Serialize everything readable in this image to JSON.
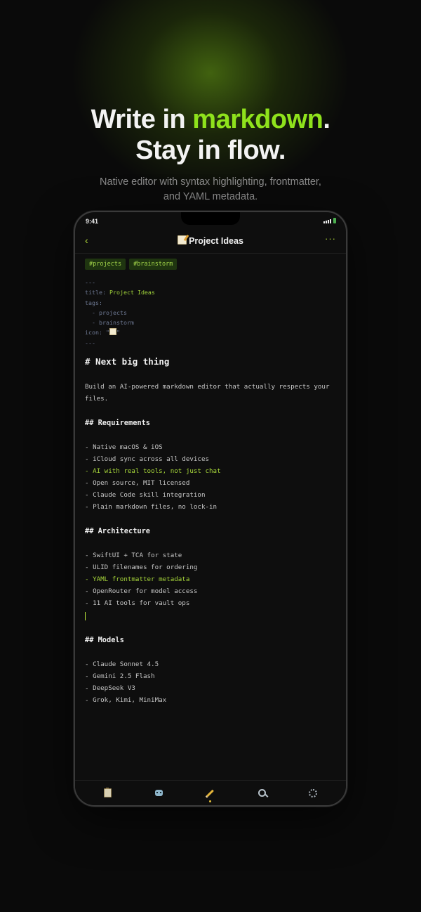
{
  "hero": {
    "title_line1_prefix": "Write in ",
    "title_line1_accent": "markdown",
    "title_line1_suffix": ".",
    "title_line2": "Stay in flow.",
    "subtitle": "Native editor with syntax highlighting, frontmatter, and YAML metadata."
  },
  "status_bar": {
    "time": "9:41"
  },
  "navbar": {
    "back": "‹",
    "title": "Project Ideas",
    "more": "···"
  },
  "tags": [
    "#projects",
    "#brainstorm"
  ],
  "frontmatter": {
    "open": "---",
    "title_key": "title:",
    "title_value": "Project Ideas",
    "tags_key": "tags:",
    "tag_items": [
      "  - projects",
      "  - brainstorm"
    ],
    "icon_key": "icon:",
    "icon_quote_open": "\"",
    "icon_quote_close": "\"",
    "close": "---"
  },
  "document": {
    "h1": "# Next big thing",
    "paragraph": "Build an AI-powered markdown editor that actually respects your files.",
    "sections": [
      {
        "heading": "## Requirements",
        "items": [
          {
            "text": "- Native macOS & iOS",
            "highlight": false
          },
          {
            "text": "- iCloud sync across all devices",
            "highlight": false
          },
          {
            "text": "- AI with real tools, not just chat",
            "highlight": true
          },
          {
            "text": "- Open source, MIT licensed",
            "highlight": false
          },
          {
            "text": "- Claude Code skill integration",
            "highlight": false
          },
          {
            "text": "- Plain markdown files, no lock-in",
            "highlight": false
          }
        ]
      },
      {
        "heading": "## Architecture",
        "items": [
          {
            "text": "- SwiftUI + TCA for state",
            "highlight": false
          },
          {
            "text": "- ULID filenames for ordering",
            "highlight": false
          },
          {
            "text": "- YAML frontmatter metadata",
            "highlight": true
          },
          {
            "text": "- OpenRouter for model access",
            "highlight": false
          },
          {
            "text": "- 11 AI tools for vault ops",
            "highlight": false
          }
        ]
      },
      {
        "heading": "## Models",
        "items": [
          {
            "text": "- Claude Sonnet 4.5",
            "highlight": false
          },
          {
            "text": "- Gemini 2.5 Flash",
            "highlight": false
          },
          {
            "text": "- DeepSeek V3",
            "highlight": false
          },
          {
            "text": "- Grok, Kimi, MiniMax",
            "highlight": false
          }
        ]
      }
    ]
  },
  "tabbar": {
    "tabs": [
      {
        "name": "notes",
        "icon": "clipboard-icon",
        "active": false
      },
      {
        "name": "assistant",
        "icon": "robot-icon",
        "active": false
      },
      {
        "name": "editor",
        "icon": "pencil-icon",
        "active": true
      },
      {
        "name": "search",
        "icon": "search-icon",
        "active": false
      },
      {
        "name": "settings",
        "icon": "gear-icon",
        "active": false
      }
    ]
  },
  "colors": {
    "accent": "#8fe21c",
    "tag_bg": "#1f3510",
    "background": "#0a0a0a"
  }
}
